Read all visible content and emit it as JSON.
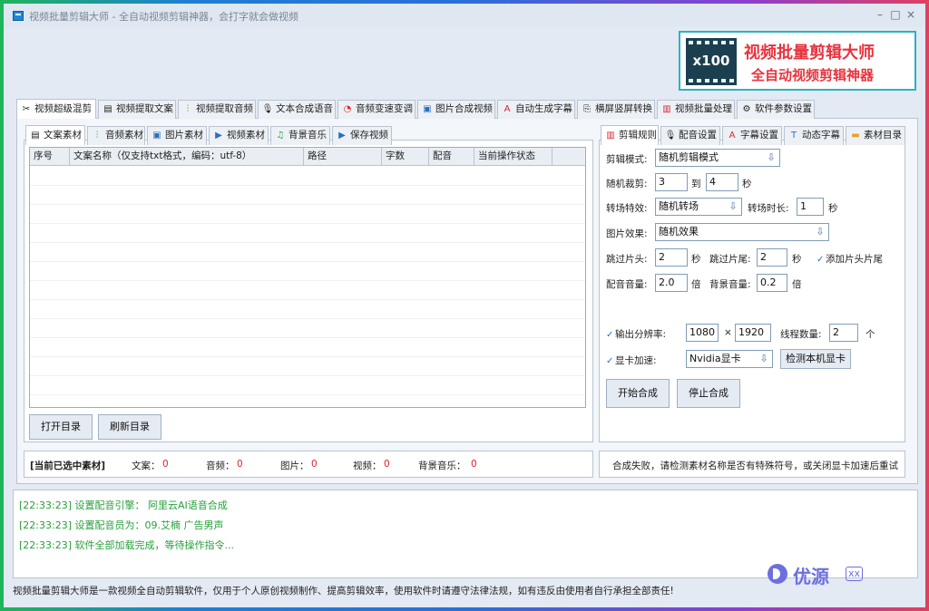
{
  "window": {
    "title": "视频批量剪辑大师 - 全自动视频剪辑神器，会打字就会做视频",
    "minimize": "–",
    "maximize": "□",
    "close": "×"
  },
  "logo": {
    "badge": "x100",
    "line1": "视频批量剪辑大师",
    "line2": "全自动视频剪辑神器"
  },
  "main_tabs": [
    {
      "label": "视频超级混剪",
      "icon": "scissors-icon",
      "glyph": "✂"
    },
    {
      "label": "视频提取文案",
      "icon": "document-icon",
      "glyph": "▤"
    },
    {
      "label": "视频提取音频",
      "icon": "audio-wave-icon",
      "glyph": "⫶"
    },
    {
      "label": "文本合成语音",
      "icon": "microphone-icon",
      "glyph": "🎙"
    },
    {
      "label": "音频变速变调",
      "icon": "gauge-icon",
      "glyph": "◔"
    },
    {
      "label": "图片合成视频",
      "icon": "image-icon",
      "glyph": "▣"
    },
    {
      "label": "自动生成字幕",
      "icon": "font-icon",
      "glyph": "A"
    },
    {
      "label": "横屏竖屏转换",
      "icon": "rotate-screen-icon",
      "glyph": "⎘"
    },
    {
      "label": "视频批量处理",
      "icon": "film-icon",
      "glyph": "▥"
    },
    {
      "label": "软件参数设置",
      "icon": "gear-icon",
      "glyph": "⚙"
    }
  ],
  "left_tabs": [
    {
      "label": "文案素材",
      "icon": "document-icon",
      "glyph": "▤"
    },
    {
      "label": "音频素材",
      "icon": "audio-wave-icon",
      "glyph": "⫶"
    },
    {
      "label": "图片素材",
      "icon": "image-icon",
      "glyph": "▣"
    },
    {
      "label": "视频素材",
      "icon": "play-icon",
      "glyph": "▶"
    },
    {
      "label": "背景音乐",
      "icon": "music-note-icon",
      "glyph": "♫"
    },
    {
      "label": "保存视频",
      "icon": "save-icon",
      "glyph": "▶"
    }
  ],
  "grid": {
    "columns": [
      "序号",
      "文案名称（仅支持txt格式，编码：utf-8）",
      "路径",
      "字数",
      "配音",
      "当前操作状态"
    ],
    "rows": []
  },
  "left_buttons": {
    "open": "打开目录",
    "refresh": "刷新目录"
  },
  "status": {
    "title": "[当前已选中素材]",
    "items": [
      {
        "label": "文案：",
        "value": "0"
      },
      {
        "label": "音频：",
        "value": "0"
      },
      {
        "label": "图片：",
        "value": "0"
      },
      {
        "label": "视频：",
        "value": "0"
      },
      {
        "label": "背景音乐：",
        "value": "0"
      }
    ]
  },
  "right_tabs": [
    {
      "label": "剪辑规则",
      "icon": "film-icon",
      "glyph": "▥"
    },
    {
      "label": "配音设置",
      "icon": "microphone-icon",
      "glyph": "🎙"
    },
    {
      "label": "字幕设置",
      "icon": "font-icon",
      "glyph": "A"
    },
    {
      "label": "动态字幕",
      "icon": "text-box-icon",
      "glyph": "T"
    },
    {
      "label": "素材目录",
      "icon": "folder-icon",
      "glyph": "▬"
    }
  ],
  "settings": {
    "edit_mode": {
      "label": "剪辑模式:",
      "value": "随机剪辑模式"
    },
    "random_cut": {
      "label": "随机裁剪:",
      "from": "3",
      "to_label": "到",
      "to": "4",
      "unit": "秒"
    },
    "transition": {
      "label": "转场特效:",
      "value": "随机转场",
      "dur_label": "转场时长:",
      "dur": "1",
      "unit": "秒"
    },
    "image_effect": {
      "label": "图片效果:",
      "value": "随机效果"
    },
    "skip": {
      "head_label": "跳过片头:",
      "head": "2",
      "head_unit": "秒",
      "tail_label": "跳过片尾:",
      "tail": "2",
      "tail_unit": "秒",
      "add_label": "添加片头片尾"
    },
    "volume": {
      "dub_label": "配音音量:",
      "dub": "2.0",
      "dub_unit": "倍",
      "bg_label": "背景音量:",
      "bg": "0.2",
      "bg_unit": "倍"
    },
    "resolution": {
      "label": "输出分辨率:",
      "w": "1080",
      "x": "×",
      "h": "1920",
      "threads_label": "线程数量:",
      "threads": "2",
      "threads_unit": "个"
    },
    "gpu": {
      "label": "显卡加速:",
      "value": "Nvidia显卡",
      "detect": "检测本机显卡"
    },
    "start": "开始合成",
    "stop": "停止合成"
  },
  "error_msg": "合成失败，请检测素材名称是否有特殊符号，或关闭显卡加速后重试",
  "log": [
    "[22:33:23] 设置配音引擎：  阿里云AI语音合成",
    "[22:33:23] 设置配音员为：09.艾楠 广告男声",
    "[22:33:23] 软件全部加载完成，等待操作指令..."
  ],
  "footer": "视频批量剪辑大师是一款视频全自动剪辑软件，仅用于个人原创视频制作、提高剪辑效率，使用软件时请遵守法律法规，如有违反由使用者自行承担全部责任!",
  "watermark": {
    "text": "优源",
    "sub": "xx"
  },
  "colors": {
    "accent": "#1e88d8",
    "error": "#e0242b",
    "log": "#28a03c",
    "logo": "#e8333d"
  }
}
